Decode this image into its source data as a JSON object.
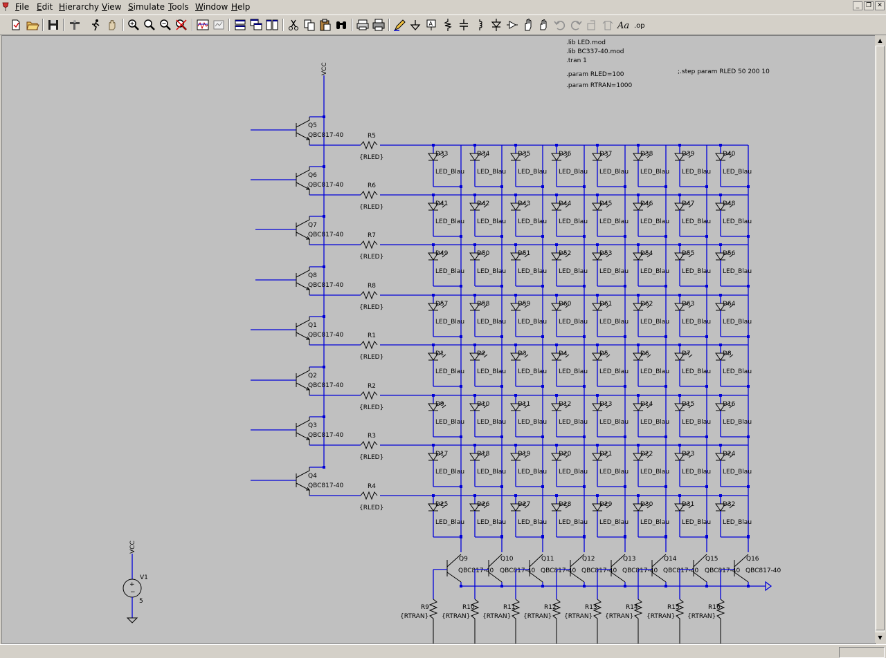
{
  "menubar": {
    "items": [
      {
        "id": "file",
        "label": "File"
      },
      {
        "id": "edit",
        "label": "Edit"
      },
      {
        "id": "hierarchy",
        "label": "Hierarchy"
      },
      {
        "id": "view",
        "label": "View"
      },
      {
        "id": "simulate",
        "label": "Simulate"
      },
      {
        "id": "tools",
        "label": "Tools"
      },
      {
        "id": "window",
        "label": "Window"
      },
      {
        "id": "help",
        "label": "Help"
      }
    ]
  },
  "toolbar": {
    "icons": [
      "new-schematic-icon",
      "open-icon",
      "save-icon",
      "control-panel-icon",
      "run-icon",
      "halt-icon",
      "zoom-in-icon",
      "zoom-pan-icon",
      "zoom-out-icon",
      "zoom-fit-icon",
      "waveform-icon",
      "autorange-icon",
      "tile-horizontal-icon",
      "cascade-icon",
      "tile-vertical-icon",
      "cut-icon",
      "copy-icon",
      "paste-icon",
      "find-icon",
      "print-preview-icon",
      "print-icon",
      "draw-wire-icon",
      "ground-icon",
      "label-net-icon",
      "resistor-icon",
      "capacitor-icon",
      "inductor-icon",
      "diode-icon",
      "component-icon",
      "move-icon",
      "drag-icon",
      "undo-icon",
      "redo-icon",
      "rotate-icon",
      "mirror-icon",
      "text-icon",
      "spice-directive-icon"
    ],
    "text_glyphs": {
      "text": "Aa",
      "directive": ".op"
    }
  },
  "schematic": {
    "directives": [
      ".lib LED.mod",
      ".lib BC337-40.mod",
      ".tran 1",
      ".param RLED=100",
      ".param RTRAN=1000"
    ],
    "commented_directive": ";.step param RLED 50 200 10",
    "vcc_net": "VCC",
    "row_transistors": [
      {
        "name": "Q5",
        "model": "QBC817-40"
      },
      {
        "name": "Q6",
        "model": "QBC817-40"
      },
      {
        "name": "Q7",
        "model": "QBC817-40"
      },
      {
        "name": "Q8",
        "model": "QBC817-40"
      },
      {
        "name": "Q1",
        "model": "QBC817-40"
      },
      {
        "name": "Q2",
        "model": "QBC817-40"
      },
      {
        "name": "Q3",
        "model": "QBC817-40"
      },
      {
        "name": "Q4",
        "model": "QBC817-40"
      }
    ],
    "row_resistors": [
      {
        "name": "R5",
        "value": "{RLED}"
      },
      {
        "name": "R6",
        "value": "{RLED}"
      },
      {
        "name": "R7",
        "value": "{RLED}"
      },
      {
        "name": "R8",
        "value": "{RLED}"
      },
      {
        "name": "R1",
        "value": "{RLED}"
      },
      {
        "name": "R2",
        "value": "{RLED}"
      },
      {
        "name": "R3",
        "value": "{RLED}"
      },
      {
        "name": "R4",
        "value": "{RLED}"
      }
    ],
    "led_grid": [
      [
        "D33",
        "D34",
        "D35",
        "D36",
        "D37",
        "D38",
        "D39",
        "D40"
      ],
      [
        "D41",
        "D42",
        "D43",
        "D44",
        "D45",
        "D46",
        "D47",
        "D48"
      ],
      [
        "D49",
        "D50",
        "D51",
        "D52",
        "D53",
        "D54",
        "D55",
        "D56"
      ],
      [
        "D57",
        "D58",
        "D59",
        "D60",
        "D61",
        "D62",
        "D63",
        "D64"
      ],
      [
        "D1",
        "D2",
        "D3",
        "D4",
        "D5",
        "D6",
        "D7",
        "D8"
      ],
      [
        "D9",
        "D10",
        "D11",
        "D12",
        "D13",
        "D14",
        "D15",
        "D16"
      ],
      [
        "D17",
        "D18",
        "D19",
        "D20",
        "D21",
        "D22",
        "D23",
        "D24"
      ],
      [
        "D25",
        "D26",
        "D27",
        "D28",
        "D29",
        "D30",
        "D31",
        "D32"
      ]
    ],
    "led_model": "LED_Blau",
    "column_transistors": [
      {
        "name": "Q9",
        "model": "QBC817-40"
      },
      {
        "name": "Q10",
        "model": "QBC817-40"
      },
      {
        "name": "Q11",
        "model": "QBC817-40"
      },
      {
        "name": "Q12",
        "model": "QBC817-40"
      },
      {
        "name": "Q13",
        "model": "QBC817-40"
      },
      {
        "name": "Q14",
        "model": "QBC817-40"
      },
      {
        "name": "Q15",
        "model": "QBC817-40"
      },
      {
        "name": "Q16",
        "model": "QBC817-40"
      }
    ],
    "column_resistors": [
      {
        "name": "R9",
        "value": "{RTRAN}"
      },
      {
        "name": "R10",
        "value": "{RTRAN}"
      },
      {
        "name": "R11",
        "value": "{RTRAN}"
      },
      {
        "name": "R12",
        "value": "{RTRAN}"
      },
      {
        "name": "R13",
        "value": "{RTRAN}"
      },
      {
        "name": "R14",
        "value": "{RTRAN}"
      },
      {
        "name": "R15",
        "value": "{RTRAN}"
      },
      {
        "name": "R16",
        "value": "{RTRAN}"
      }
    ],
    "source": {
      "name": "V1",
      "value": "5",
      "net": "VCC"
    }
  },
  "statusbar": {
    "text": ""
  }
}
